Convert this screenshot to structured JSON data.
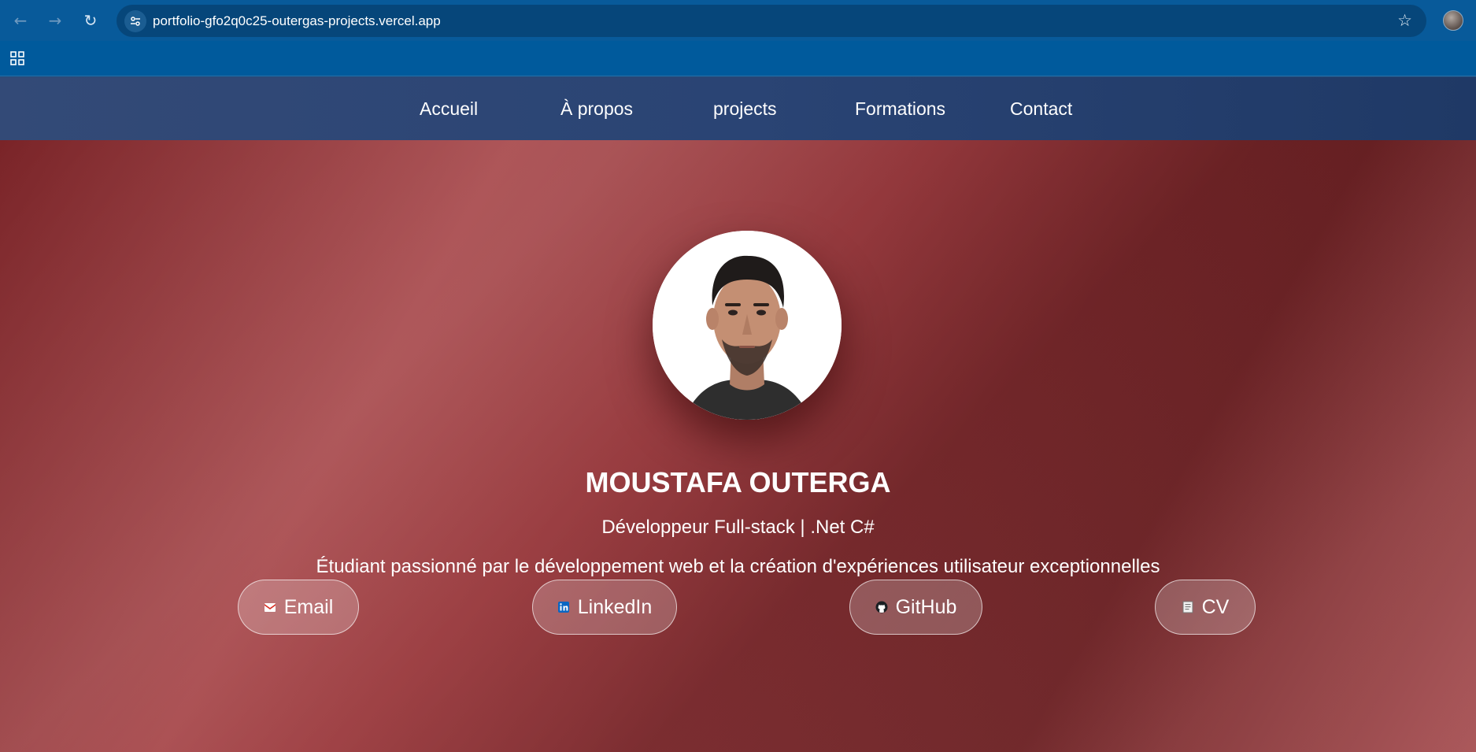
{
  "browser": {
    "url": "portfolio-gfo2q0c25-outergas-projects.vercel.app",
    "back_icon": "back-arrow-icon",
    "forward_icon": "forward-arrow-icon",
    "reload_icon": "reload-icon",
    "bookmark_icon": "star-icon",
    "apps_icon": "apps-grid-icon"
  },
  "nav": {
    "items": [
      {
        "label": "Accueil"
      },
      {
        "label": "À propos"
      },
      {
        "label": "projects"
      },
      {
        "label": "Formations"
      },
      {
        "label": "Contact"
      }
    ]
  },
  "hero": {
    "name": "MOUSTAFA OUTERGA",
    "role": "Développeur Full-stack | .Net C#",
    "tagline": "Étudiant passionné par le développement web et la création d'expériences utilisateur exceptionnelles",
    "links": [
      {
        "label": "Email",
        "icon": "email-icon"
      },
      {
        "label": "LinkedIn",
        "icon": "linkedin-icon"
      },
      {
        "label": "GitHub",
        "icon": "github-icon"
      },
      {
        "label": "CV",
        "icon": "document-icon"
      }
    ]
  },
  "colors": {
    "browser_bar": "#085a9a",
    "nav_background": "#2a4474",
    "hero_accent": "#a84a4d"
  }
}
